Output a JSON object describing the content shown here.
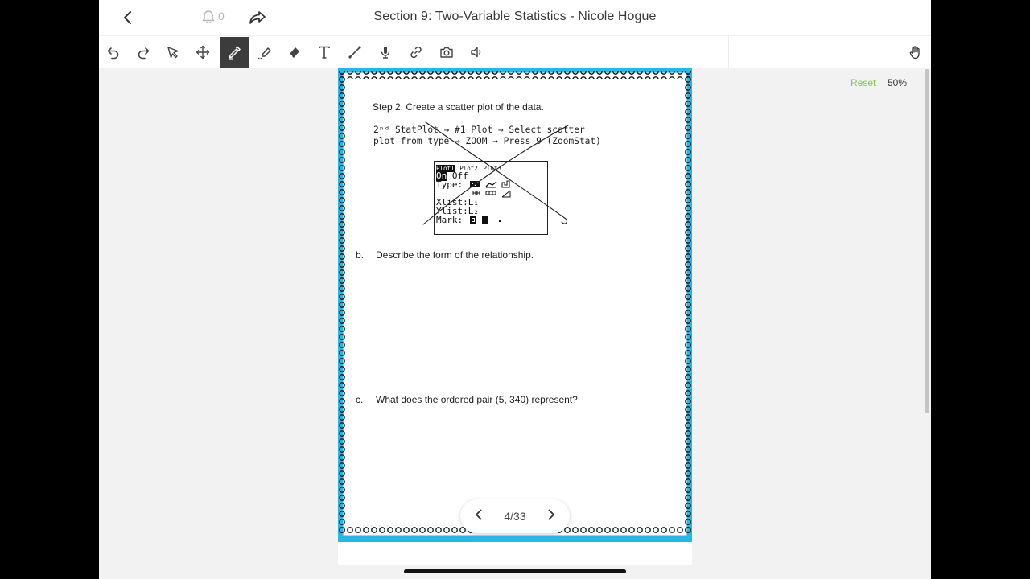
{
  "header": {
    "title": "Section 9: Two-Variable Statistics - Nicole Hogue",
    "notification_count": "0",
    "icons": {
      "back": "chevron-left-icon",
      "bell": "bell-icon",
      "share": "share-icon"
    }
  },
  "toolbar": {
    "tools": [
      {
        "name": "undo",
        "icon": "undo-icon"
      },
      {
        "name": "redo",
        "icon": "redo-icon"
      },
      {
        "name": "select",
        "icon": "cursor-icon"
      },
      {
        "name": "move",
        "icon": "move-icon"
      },
      {
        "name": "pen",
        "icon": "pen-icon",
        "active": true
      },
      {
        "name": "highlighter",
        "icon": "highlighter-icon"
      },
      {
        "name": "eraser",
        "icon": "eraser-icon"
      },
      {
        "name": "text",
        "icon": "text-icon"
      },
      {
        "name": "line",
        "icon": "line-icon"
      },
      {
        "name": "microphone",
        "icon": "microphone-icon"
      },
      {
        "name": "link",
        "icon": "link-icon"
      },
      {
        "name": "camera",
        "icon": "camera-icon"
      },
      {
        "name": "audio",
        "icon": "speaker-icon"
      },
      {
        "name": "hand",
        "icon": "hand-icon"
      }
    ],
    "active_color": "#3c3c3c"
  },
  "zoom": {
    "reset_label": "Reset",
    "level": "50%",
    "reset_color": "#8bc34a"
  },
  "document": {
    "frame_color": "#29b6e6",
    "step2": "Step 2. Create a scatter plot of the data.",
    "instr_line1": "2ⁿᵈ StatPlot → #1 Plot → Select scatter",
    "instr_line2": "plot from type → ZOOM → Press 9 (ZoomStat)",
    "calculator": {
      "tabs": [
        "Plot1",
        "Plot2",
        "Plot3"
      ],
      "on": "On",
      "off": "Off",
      "type_label": "Type:",
      "xlist": "Xlist:L₁",
      "ylist": "Ylist:L₂",
      "mark_label": "Mark:"
    },
    "question_b_label": "b.",
    "question_b": "Describe the form of the relationship.",
    "question_c_label": "c.",
    "question_c": "What does the ordered pair (5, 340) represent?"
  },
  "pager": {
    "current": "4/33",
    "prev_icon": "chevron-left-icon",
    "next_icon": "chevron-right-icon"
  }
}
